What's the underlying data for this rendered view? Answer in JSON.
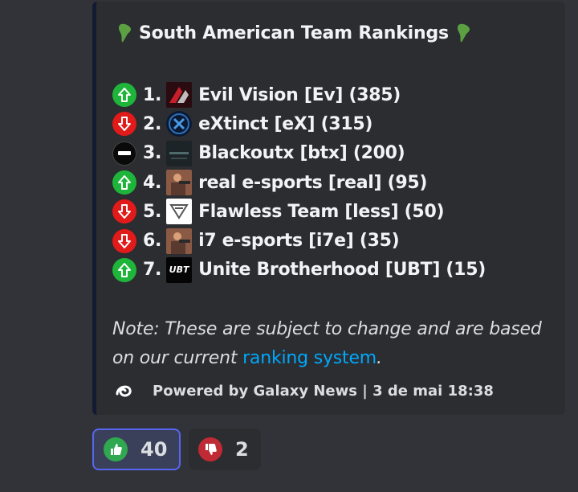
{
  "embed": {
    "title": "South American Team Rankings",
    "title_icon": "south-america-map-emoji",
    "accent_color": "#141a33",
    "rankings": [
      {
        "trend": "up",
        "position": "1.",
        "team": "Evil Vision [Ev] (385)"
      },
      {
        "trend": "down",
        "position": "2.",
        "team": "eXtinct [eX] (315)"
      },
      {
        "trend": "same",
        "position": "3.",
        "team": "Blackoutx [btx] (200)"
      },
      {
        "trend": "up",
        "position": "4.",
        "team": "real e-sports [real] (95)"
      },
      {
        "trend": "down",
        "position": "5.",
        "team": "Flawless Team [less] (50)"
      },
      {
        "trend": "down",
        "position": "6.",
        "team": "i7 e-sports [i7e] (35)"
      },
      {
        "trend": "up",
        "position": "7.",
        "team": "Unite Brotherhood [UBT] (15)"
      }
    ],
    "note_prefix": "Note: These are subject to change and are based on our current ",
    "note_link": "ranking system",
    "note_suffix": ".",
    "footer": "Powered by Galaxy News | 3 de mai 18:38",
    "logo_text_ubt": "UBT"
  },
  "reactions": [
    {
      "emoji": "thumbs-up",
      "count": "40",
      "selected": true
    },
    {
      "emoji": "thumbs-down",
      "count": "2",
      "selected": false
    }
  ],
  "colors": {
    "up": "#1fb53b",
    "down": "#e11a1a",
    "link": "#00a8fc"
  }
}
